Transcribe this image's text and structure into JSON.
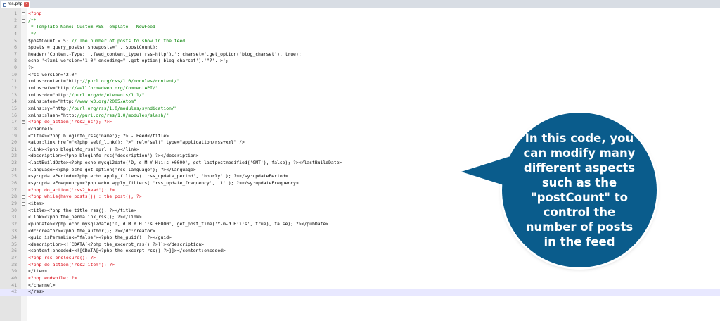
{
  "tab": {
    "filename": "rss.php",
    "close_glyph": "×"
  },
  "callout": {
    "text": "In this code, you can modify many different aspects such as the \"postCount\" to control the number of posts in the feed"
  },
  "lines": [
    {
      "n": "1",
      "code": "<?php"
    },
    {
      "n": "2",
      "code": "/**"
    },
    {
      "n": "3",
      "code": " * Template Name: Custom RSS Template - NewFeed"
    },
    {
      "n": "4",
      "code": " */"
    },
    {
      "n": "5",
      "code": "$postCount = 5; // The number of posts to show in the feed"
    },
    {
      "n": "6",
      "code": "$posts = query_posts('showposts=' . $postCount);"
    },
    {
      "n": "7",
      "code": "header('Content-Type: '.feed_content_type('rss-http').'; charset='.get_option('blog_charset'), true);"
    },
    {
      "n": "8",
      "code": "echo '<?xml version=\"1.0\" encoding=\"'.get_option('blog_charset').'\"?'.'>';"
    },
    {
      "n": "9",
      "code": "?>"
    },
    {
      "n": "10",
      "code": "<rss version=\"2.0\""
    },
    {
      "n": "11",
      "code": "xmlns:content=\"http://purl.org/rss/1.0/modules/content/\""
    },
    {
      "n": "12",
      "code": "xmlns:wfw=\"http://wellformedweb.org/CommentAPI/\""
    },
    {
      "n": "13",
      "code": "xmlns:dc=\"http://purl.org/dc/elements/1.1/\""
    },
    {
      "n": "14",
      "code": "xmlns:atom=\"http://www.w3.org/2005/Atom\""
    },
    {
      "n": "15",
      "code": "xmlns:sy=\"http://purl.org/rss/1.0/modules/syndication/\""
    },
    {
      "n": "16",
      "code": "xmlns:slash=\"http://purl.org/rss/1.0/modules/slash/\""
    },
    {
      "n": "17",
      "code": "<?php do_action('rss2_ns'); ?>>"
    },
    {
      "n": "18",
      "code": "<channel>"
    },
    {
      "n": "19",
      "code": "<title><?php bloginfo_rss('name'); ?> - Feed</title>"
    },
    {
      "n": "20",
      "code": "<atom:link href=\"<?php self_link(); ?>\" rel=\"self\" type=\"application/rss+xml\" />"
    },
    {
      "n": "21",
      "code": "<link><?php bloginfo_rss('url') ?></link>"
    },
    {
      "n": "22",
      "code": "<description><?php bloginfo_rss('description') ?></description>"
    },
    {
      "n": "23",
      "code": "<lastBuildDate><?php echo mysql2date('D, d M Y H:i:s +0000', get_lastpostmodified('GMT'), false); ?></lastBuildDate>"
    },
    {
      "n": "24",
      "code": "<language><?php echo get_option('rss_language'); ?></language>"
    },
    {
      "n": "25",
      "code": "<sy:updatePeriod><?php echo apply_filters( 'rss_update_period', 'hourly' ); ?></sy:updatePeriod>"
    },
    {
      "n": "26",
      "code": "<sy:updateFrequency><?php echo apply_filters( 'rss_update_frequency', '1' ); ?></sy:updateFrequency>"
    },
    {
      "n": "27",
      "code": "<?php do_action('rss2_head'); ?>"
    },
    {
      "n": "28",
      "code": "<?php while(have_posts()) : the_post(); ?>"
    },
    {
      "n": "29",
      "code": "<item>"
    },
    {
      "n": "30",
      "code": "<title><?php the_title_rss(); ?></title>"
    },
    {
      "n": "31",
      "code": "<link><?php the_permalink_rss(); ?></link>"
    },
    {
      "n": "32",
      "code": "<pubDate><?php echo mysql2date('D, d M Y H:i:s +0000', get_post_time('Y-m-d H:i:s', true), false); ?></pubDate>"
    },
    {
      "n": "33",
      "code": "<dc:creator><?php the_author(); ?></dc:creator>"
    },
    {
      "n": "34",
      "code": "<guid isPermaLink=\"false\"><?php the_guid(); ?></guid>"
    },
    {
      "n": "35",
      "code": "<description><![CDATA[<?php the_excerpt_rss() ?>]]></description>"
    },
    {
      "n": "36",
      "code": "<content:encoded><![CDATA[<?php the_excerpt_rss() ?>]]></content:encoded>"
    },
    {
      "n": "37",
      "code": "<?php rss_enclosure(); ?>"
    },
    {
      "n": "38",
      "code": "<?php do_action('rss2_item'); ?>"
    },
    {
      "n": "39",
      "code": "</item>"
    },
    {
      "n": "40",
      "code": "<?php endwhile; ?>"
    },
    {
      "n": "41",
      "code": "</channel>"
    },
    {
      "n": "42",
      "code": "</rss>"
    }
  ],
  "colors": {
    "php": "#d8000d",
    "comment": "#008000",
    "string": "#808080",
    "keyword": "#0000ff",
    "callout_bg": "#0a5c8c",
    "current_line": "#e8e8ff"
  }
}
